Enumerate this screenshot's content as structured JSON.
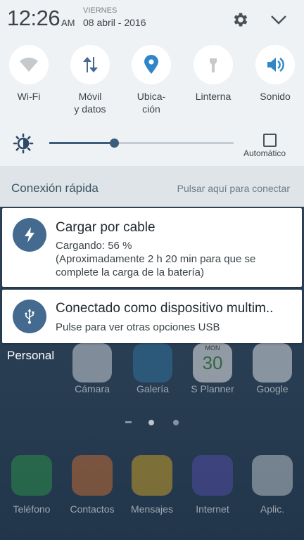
{
  "status": {
    "time": "12:26",
    "ampm": "AM",
    "weekday": "VIERNES",
    "date": "08 abril - 2016"
  },
  "quick_settings": [
    {
      "label": "Wi-Fi",
      "icon": "wifi-icon",
      "active": false
    },
    {
      "label": "Móvil\ny datos",
      "icon": "mobile-data-icon",
      "active": true
    },
    {
      "label": "Ubica-\nción",
      "icon": "location-icon",
      "active": true
    },
    {
      "label": "Linterna",
      "icon": "flashlight-icon",
      "active": false
    },
    {
      "label": "Sonido",
      "icon": "sound-icon",
      "active": true
    }
  ],
  "brightness": {
    "level": 0.35,
    "auto_label": "Automático",
    "auto_checked": false
  },
  "quick_connect": {
    "title": "Conexión rápida",
    "hint": "Pulsar aquí para conectar"
  },
  "notifications": [
    {
      "icon": "charging-bolt-icon",
      "title": "Cargar por cable",
      "line1": "Cargando: 56 %",
      "line2": "(Aproximadamente 2 h 20 min para que se",
      "line3": "complete la carga de la batería)"
    },
    {
      "icon": "usb-icon",
      "title": "Conectado como dispositivo multim..",
      "line1": "Pulse para ver otras opciones USB"
    }
  ],
  "home": {
    "folder_label": "Personal",
    "row_apps": [
      "Cámara",
      "Galería",
      "S Planner",
      "Google"
    ],
    "calendar_day": "30",
    "calendar_weekday": "MON",
    "dock_apps": [
      "Teléfono",
      "Contactos",
      "Mensajes",
      "Internet",
      "Aplic."
    ]
  },
  "colors": {
    "accent": "#446b8f",
    "shade_bg": "#eff2f5",
    "quick_connect_bg": "#dfe4e8"
  }
}
